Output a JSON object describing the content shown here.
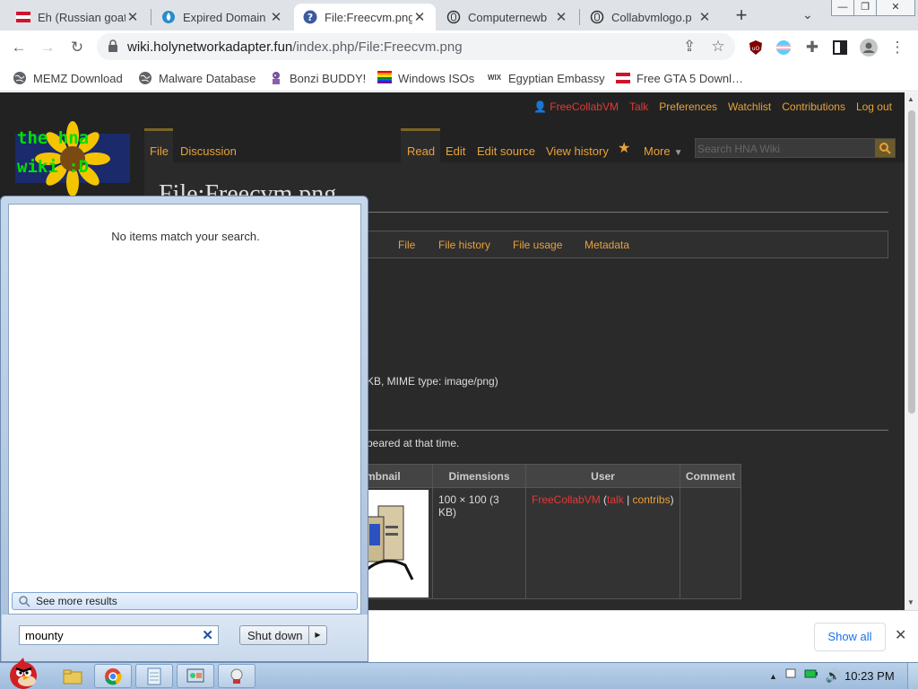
{
  "browser": {
    "tabs": [
      {
        "title": "Eh (Russian goat",
        "icon": "flag-icon"
      },
      {
        "title": "Expired Domain",
        "icon": "droplet-icon"
      },
      {
        "title": "File:Freecvm.png",
        "icon": "question-icon",
        "active": true
      },
      {
        "title": "Computernewb",
        "icon": "mouse-icon"
      },
      {
        "title": "Collabvmlogo.p",
        "icon": "mouse-icon"
      }
    ],
    "url_host": "wiki.holynetworkadapter.fun",
    "url_path": "/index.php/File:Freecvm.png",
    "bookmarks": [
      {
        "label": "MEMZ Download",
        "icon": "globe-icon"
      },
      {
        "label": "Malware Database",
        "icon": "globe-icon"
      },
      {
        "label": "Bonzi BUDDY!",
        "icon": "bonzi-icon"
      },
      {
        "label": "Windows ISOs",
        "icon": "rainbow-flag-icon"
      },
      {
        "label": "Egyptian Embassy",
        "icon": "wix-icon"
      },
      {
        "label": "Free GTA 5 Downl…",
        "icon": "flag-icon"
      }
    ],
    "wix_text": "WIX"
  },
  "wiki": {
    "logo_line1": "the hna",
    "logo_line2": "wiki :D",
    "personal": {
      "user": "FreeCollabVM",
      "talk": "Talk",
      "preferences": "Preferences",
      "watchlist": "Watchlist",
      "contributions": "Contributions",
      "logout": "Log out"
    },
    "tabs": {
      "file": "File",
      "discussion": "Discussion",
      "read": "Read",
      "edit": "Edit",
      "edit_source": "Edit source",
      "view_history": "View history",
      "more": "More"
    },
    "search_placeholder": "Search HNA Wiki",
    "page_title": "File:Freecvm.png",
    "filetoc": {
      "file": "File",
      "history": "File history",
      "usage": "File usage",
      "metadata": "Metadata"
    },
    "file_info_fragment": "KB, MIME type: image/png)",
    "history_text_fragment": "peared at that time.",
    "table": {
      "headers": {
        "thumb": "mbnail",
        "dimensions": "Dimensions",
        "user": "User",
        "comment": "Comment"
      },
      "row": {
        "dimensions": "100 × 100 (3 KB)",
        "user": "FreeCollabVM",
        "talk": "talk",
        "sep": "|",
        "contribs": "contribs",
        "paren_open": "(",
        "paren_close": ")",
        "comment": ""
      }
    }
  },
  "startmenu": {
    "no_items": "No items match your search.",
    "see_more": "See more results",
    "search_value": "mounty",
    "shutdown": "Shut down"
  },
  "download_bar": {
    "show_all": "Show all"
  },
  "taskbar": {
    "time": "10:23 PM"
  }
}
